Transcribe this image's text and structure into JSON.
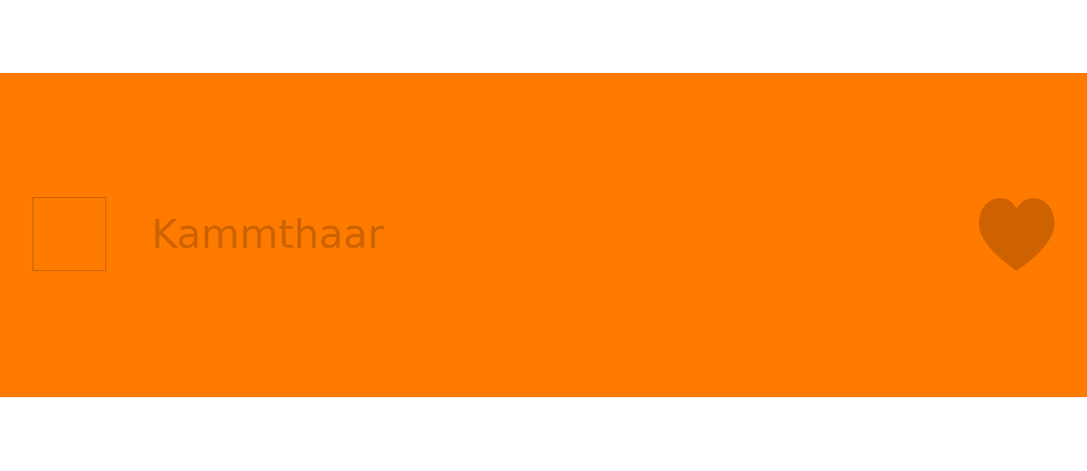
{
  "item": {
    "label": "Kammthaar",
    "favorite_icon": "heart-icon",
    "favorited": true
  },
  "colors": {
    "row_background": "#ff7b00",
    "label_text": "#cc6200",
    "heart_fill": "#cf6200",
    "thumbnail_border": "#c4600b",
    "page_background": "#ffffff"
  }
}
